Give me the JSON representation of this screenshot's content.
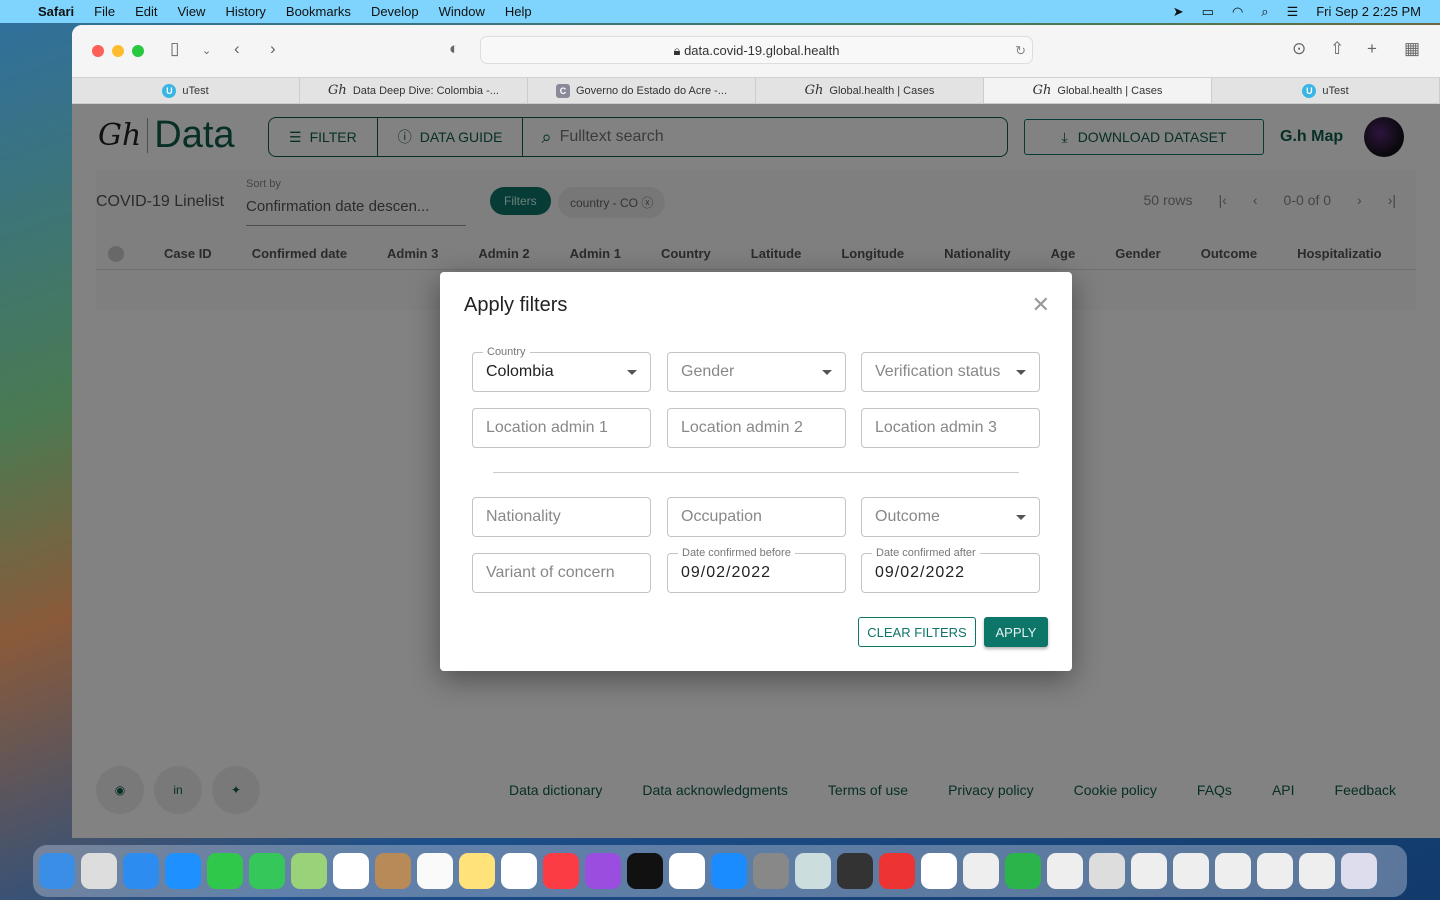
{
  "menubar": {
    "app": "Safari",
    "items": [
      "File",
      "Edit",
      "View",
      "History",
      "Bookmarks",
      "Develop",
      "Window",
      "Help"
    ],
    "clock": "Fri Sep 2  2:25 PM"
  },
  "browser": {
    "url": "data.covid-19.global.health",
    "tabs": [
      {
        "label": "uTest",
        "icon": "U"
      },
      {
        "label": "Data Deep Dive: Colombia -...",
        "icon": "Gh"
      },
      {
        "label": "Governo do Estado do Acre -...",
        "icon": "C"
      },
      {
        "label": "Global.health | Cases",
        "icon": "Gh"
      },
      {
        "label": "Global.health | Cases",
        "icon": "Gh",
        "active": true
      },
      {
        "label": "uTest",
        "icon": "U"
      }
    ]
  },
  "header": {
    "logo_mark": "Gh",
    "logo_text": "Data",
    "filter": "FILTER",
    "data_guide": "DATA GUIDE",
    "search_placeholder": "Fulltext search",
    "download": "DOWNLOAD DATASET",
    "map": "G.h Map"
  },
  "grid": {
    "title": "COVID-19 Linelist",
    "sort_label": "Sort by",
    "sort_value": "Confirmation date descen...",
    "filters_chip": "Filters",
    "country_chip": "country - CO",
    "rows": "50 rows",
    "range": "0-0 of 0",
    "columns": [
      "Case ID",
      "Confirmed date",
      "Admin 3",
      "Admin 2",
      "Admin 1",
      "Country",
      "Latitude",
      "Longitude",
      "Nationality",
      "Age",
      "Gender",
      "Outcome",
      "Hospitalizatio"
    ]
  },
  "footer": {
    "links": [
      "Data dictionary",
      "Data acknowledgments",
      "Terms of use",
      "Privacy policy",
      "Cookie policy",
      "FAQs",
      "API",
      "Feedback"
    ]
  },
  "modal": {
    "title": "Apply filters",
    "country_label": "Country",
    "country_value": "Colombia",
    "gender": "Gender",
    "verification": "Verification status",
    "admin1": "Location admin 1",
    "admin2": "Location admin 2",
    "admin3": "Location admin 3",
    "nationality": "Nationality",
    "occupation": "Occupation",
    "outcome": "Outcome",
    "variant": "Variant of concern",
    "before_label": "Date confirmed before",
    "before_value": "09/02/2022",
    "after_label": "Date confirmed after",
    "after_value": "09/02/2022",
    "clear": "CLEAR FILTERS",
    "apply": "APPLY"
  },
  "colors": {
    "brand": "#0e7569",
    "dark_brand": "#0e5c4c"
  }
}
